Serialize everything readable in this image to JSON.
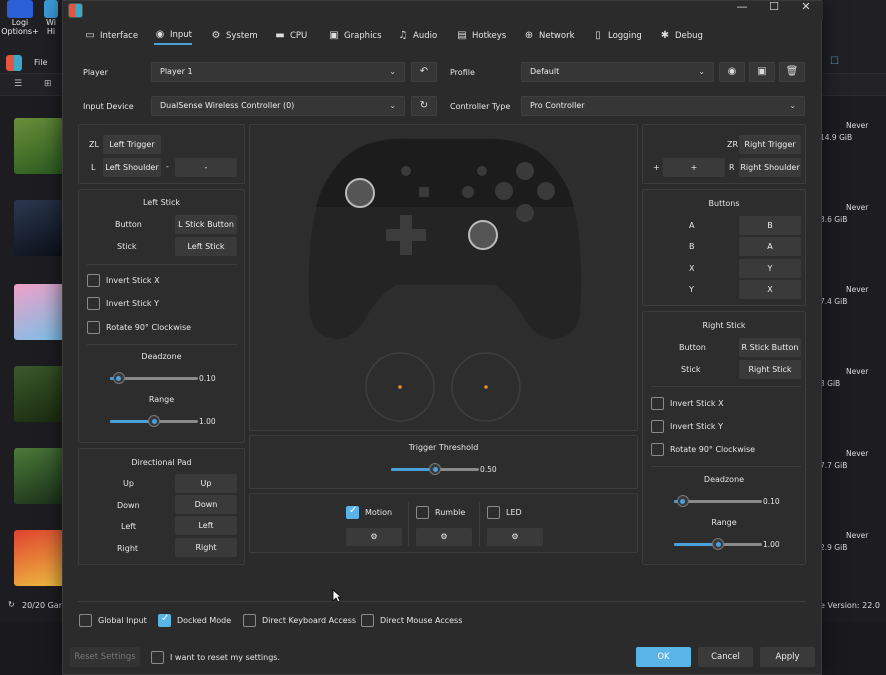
{
  "background": {
    "desktop_icons": [
      {
        "label1": "Logi",
        "label2": "Options+"
      },
      {
        "label1": "Wi",
        "label2": "Hi"
      }
    ],
    "host_menu": "File",
    "right_column": [
      {
        "played": "Never",
        "size": "14.9 GiB"
      },
      {
        "played": "Never",
        "size": "3.6 GiB"
      },
      {
        "played": "Never",
        "size": "7.4 GiB"
      },
      {
        "played": "Never",
        "size": "3 GiB"
      },
      {
        "played": "Never",
        "size": "7.7 GiB"
      },
      {
        "played": "Never",
        "size": "2.9 GiB"
      }
    ],
    "games_count": "20/20 Gar",
    "version": "e Version: 22.0"
  },
  "dialog": {
    "window_buttons": {
      "minimize": "—",
      "maximize": "☐",
      "close": "✕"
    },
    "tabs": [
      {
        "label": "Interface",
        "icon": "monitor-icon",
        "glyph": "▭"
      },
      {
        "label": "Input",
        "icon": "gamepad-icon",
        "glyph": "◉"
      },
      {
        "label": "System",
        "icon": "gear-icon",
        "glyph": "⚙"
      },
      {
        "label": "CPU",
        "icon": "cpu-icon",
        "glyph": "▬"
      },
      {
        "label": "Graphics",
        "icon": "image-icon",
        "glyph": "▣"
      },
      {
        "label": "Audio",
        "icon": "music-icon",
        "glyph": "♫"
      },
      {
        "label": "Hotkeys",
        "icon": "keyboard-icon",
        "glyph": "▤"
      },
      {
        "label": "Network",
        "icon": "globe-icon",
        "glyph": "⊕"
      },
      {
        "label": "Logging",
        "icon": "file-icon",
        "glyph": "▯"
      },
      {
        "label": "Debug",
        "icon": "bug-icon",
        "glyph": "✱"
      }
    ],
    "active_tab": "Input",
    "player_label": "Player",
    "player_value": "Player 1",
    "profile_label": "Profile",
    "profile_value": "Default",
    "input_device_label": "Input Device",
    "input_device_value": "DualSense Wireless Controller (0)",
    "controller_type_label": "Controller Type",
    "controller_type_value": "Pro Controller",
    "zl": {
      "key": "ZL",
      "value": "Left Trigger"
    },
    "l": {
      "key": "L",
      "value": "Left Shoulder"
    },
    "minus": {
      "key": "-",
      "value": "-"
    },
    "zr": {
      "key": "ZR",
      "value": "Right Trigger"
    },
    "r": {
      "key": "R",
      "value": "Right Shoulder"
    },
    "plus": {
      "key": "+",
      "value": "+"
    },
    "left_stick": {
      "title": "Left Stick",
      "button_label": "Button",
      "button_value": "L Stick Button",
      "stick_label": "Stick",
      "stick_value": "Left Stick",
      "invert_x": "Invert Stick X",
      "invert_y": "Invert Stick Y",
      "rotate": "Rotate 90° Clockwise",
      "deadzone_label": "Deadzone",
      "deadzone_value": "0.10",
      "deadzone_fraction": 0.1,
      "range_label": "Range",
      "range_value": "1.00",
      "range_fraction": 0.5
    },
    "dpad": {
      "title": "Directional Pad",
      "rows": [
        {
          "label": "Up",
          "value": "Up"
        },
        {
          "label": "Down",
          "value": "Down"
        },
        {
          "label": "Left",
          "value": "Left"
        },
        {
          "label": "Right",
          "value": "Right"
        }
      ]
    },
    "buttons": {
      "title": "Buttons",
      "rows": [
        {
          "label": "A",
          "value": "B"
        },
        {
          "label": "B",
          "value": "A"
        },
        {
          "label": "X",
          "value": "Y"
        },
        {
          "label": "Y",
          "value": "X"
        }
      ]
    },
    "right_stick": {
      "title": "Right Stick",
      "button_label": "Button",
      "button_value": "R Stick Button",
      "stick_label": "Stick",
      "stick_value": "Right Stick",
      "invert_x": "Invert Stick X",
      "invert_y": "Invert Stick Y",
      "rotate": "Rotate 90° Clockwise",
      "deadzone_label": "Deadzone",
      "deadzone_value": "0.10",
      "deadzone_fraction": 0.1,
      "range_label": "Range",
      "range_value": "1.00",
      "range_fraction": 0.5
    },
    "trigger": {
      "label": "Trigger Threshold",
      "value": "0.50",
      "fraction": 0.5
    },
    "motion_label": "Motion",
    "motion_checked": true,
    "rumble_label": "Rumble",
    "rumble_checked": false,
    "led_label": "LED",
    "led_checked": false,
    "global_input_label": "Global Input",
    "global_input_checked": false,
    "docked_mode_label": "Docked Mode",
    "docked_mode_checked": true,
    "direct_keyboard_label": "Direct Keyboard Access",
    "direct_keyboard_checked": false,
    "direct_mouse_label": "Direct Mouse Access",
    "direct_mouse_checked": false,
    "reset_settings_label": "Reset Settings",
    "reset_confirm_label": "I want to reset my settings.",
    "ok_label": "OK",
    "cancel_label": "Cancel",
    "apply_label": "Apply",
    "colors": {
      "accent": "#4aa0d8",
      "ok_button": "#5ab4e6",
      "dialog_bg": "#2b2b2b",
      "panel_bg": "#2d2d2d"
    }
  }
}
